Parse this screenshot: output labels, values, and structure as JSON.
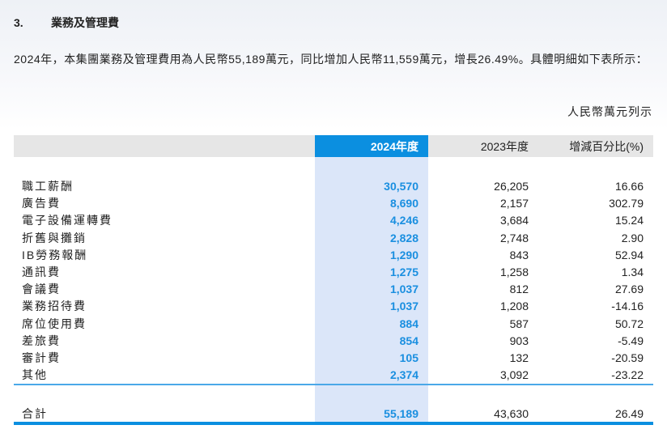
{
  "section": {
    "number": "3.",
    "title": "業務及管理費"
  },
  "paragraph": "2024年，本集團業務及管理費用為人民幣55,189萬元，同比增加人民幣11,559萬元，增長26.49%。具體明細如下表所示：",
  "unit_note": "人民幣萬元列示",
  "table": {
    "headers": [
      "",
      "2024年度",
      "2023年度",
      "增減百分比(%)"
    ],
    "rows": [
      {
        "label": "職工薪酬",
        "y2024": "30,570",
        "y2023": "26,205",
        "change": "16.66"
      },
      {
        "label": "廣告費",
        "y2024": "8,690",
        "y2023": "2,157",
        "change": "302.79"
      },
      {
        "label": "電子設備運轉費",
        "y2024": "4,246",
        "y2023": "3,684",
        "change": "15.24"
      },
      {
        "label": "折舊與攤銷",
        "y2024": "2,828",
        "y2023": "2,748",
        "change": "2.90"
      },
      {
        "label": "IB勞務報酬",
        "y2024": "1,290",
        "y2023": "843",
        "change": "52.94"
      },
      {
        "label": "通訊費",
        "y2024": "1,275",
        "y2023": "1,258",
        "change": "1.34"
      },
      {
        "label": "會議費",
        "y2024": "1,037",
        "y2023": "812",
        "change": "27.69"
      },
      {
        "label": "業務招待費",
        "y2024": "1,037",
        "y2023": "1,208",
        "change": "-14.16"
      },
      {
        "label": "席位使用費",
        "y2024": "884",
        "y2023": "587",
        "change": "50.72"
      },
      {
        "label": "差旅費",
        "y2024": "854",
        "y2023": "903",
        "change": "-5.49"
      },
      {
        "label": "審計費",
        "y2024": "105",
        "y2023": "132",
        "change": "-20.59"
      },
      {
        "label": "其他",
        "y2024": "2,374",
        "y2023": "3,092",
        "change": "-23.22"
      }
    ],
    "total": {
      "label": "合計",
      "y2024": "55,189",
      "y2023": "43,630",
      "change": "26.49"
    }
  }
}
